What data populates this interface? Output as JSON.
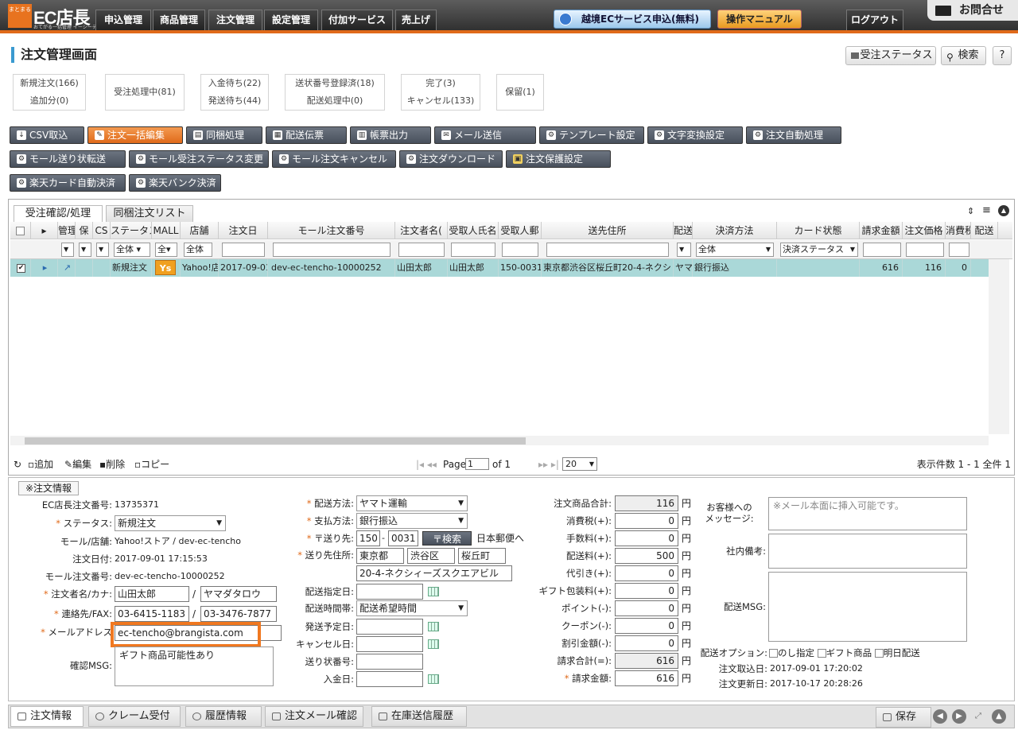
{
  "header": {
    "logo_text": "EC店長",
    "logo_box": "まとまる",
    "logo_sub": "おてがる一括管理 イーシーテンチョウ",
    "nav": [
      "申込管理",
      "商品管理",
      "注文管理",
      "設定管理",
      "付加サービス",
      "売上げ"
    ],
    "cross_border": "越境ECサービス申込(無料)",
    "manual": "操作マニュアル",
    "logout": "ログアウト",
    "contact": "お問合せ"
  },
  "page": {
    "title": "注文管理画面",
    "status_btn": "受注ステータス",
    "search_btn": "検索",
    "help_btn": "?"
  },
  "status_boxes": [
    {
      "l1": "新規注文(166)",
      "l2": "追加分(0)"
    },
    {
      "l1": "受注処理中(81)",
      "l2": ""
    },
    {
      "l1": "入金待ち(22)",
      "l2": "発送待ち(44)"
    },
    {
      "l1": "送状番号登録済(18)",
      "l2": "配送処理中(0)"
    },
    {
      "l1": "完了(3)",
      "l2": "キャンセル(133)"
    },
    {
      "l1": "保留(1)",
      "l2": ""
    }
  ],
  "actions": {
    "row1": [
      "CSV取込",
      "注文一括編集",
      "同梱処理",
      "配送伝票",
      "帳票出力",
      "メール送信",
      "テンプレート設定",
      "文字変換設定",
      "注文自動処理"
    ],
    "row2": [
      "モール送り状転送",
      "モール受注ステータス変更",
      "モール注文キャンセル",
      "注文ダウンロード",
      "注文保護設定"
    ],
    "row3": [
      "楽天カード自動決済",
      "楽天バンク決済"
    ]
  },
  "grid": {
    "tabs": [
      "受注確認/処理",
      "同梱注文リスト"
    ],
    "columns": [
      "管理",
      "保",
      "CS",
      "ステータス",
      "MALL",
      "店舗",
      "注文日",
      "モール注文番号",
      "注文者名(",
      "受取人氏名",
      "受取人郵",
      "送先住所",
      "配送",
      "決済方法",
      "カード状態",
      "請求金額",
      "注文価格",
      "消費税",
      "配送"
    ],
    "filters": {
      "status": "全体",
      "shop": "全体",
      "payment": "全体",
      "card": "決済ステータス"
    },
    "row": {
      "status": "新規注文",
      "mall": "Ys",
      "shop": "Yahoo!店",
      "date": "2017-09-01",
      "order_no": "dev-ec-tencho-10000252",
      "orderer": "山田太郎",
      "receiver": "山田太郎",
      "zip": "150-0031",
      "address": "東京都渋谷区桜丘町20-4-ネクシ",
      "ship": "ヤマ",
      "payment": "銀行振込",
      "amount": "616",
      "price": "116",
      "tax": "0"
    },
    "footer": {
      "add": "追加",
      "edit": "編集",
      "delete": "削除",
      "copy": "コピー",
      "page_label": "Page",
      "page": "1",
      "of": "of 1",
      "per_page": "20",
      "summary": "表示件数 1 - 1 全件 1"
    }
  },
  "order": {
    "section_title": "※注文情報",
    "ec_no_label": "EC店長注文番号:",
    "ec_no": "13735371",
    "status_label": "ステータス:",
    "status": "新規注文",
    "mall_label": "モール/店舗:",
    "mall": "Yahoo!ストア / dev-ec-tencho",
    "date_label": "注文日付:",
    "date": "2017-09-01 17:15:53",
    "mall_no_label": "モール注文番号:",
    "mall_no": "dev-ec-tencho-10000252",
    "name_label": "注文者名/カナ:",
    "name": "山田太郎",
    "kana": "ヤマダタロウ",
    "tel_label": "連絡先/FAX:",
    "tel": "03-6415-1183",
    "fax": "03-3476-7877",
    "mail_label": "メールアドレス",
    "mail": "ec-tencho@brangista.com",
    "confirm_label": "確認MSG:",
    "confirm": "ギフト商品可能性あり",
    "ship_method_label": "配送方法:",
    "ship_method": "ヤマト運輸",
    "pay_label": "支払方法:",
    "pay": "銀行振込",
    "zip_label": "〒送り先:",
    "zip1": "150",
    "zip2": "0031",
    "zip_search": "〒検索",
    "post_link": "日本郵便へ",
    "addr_label": "送り先住所:",
    "pref": "東京都",
    "city": "渋谷区",
    "town": "桜丘町",
    "addr2": "20-4-ネクシィーズスクエアビル",
    "ship_date_label": "配送指定日:",
    "ship_time_label": "配送時間帯:",
    "ship_time": "配送希望時間",
    "send_date_label": "発送予定日:",
    "cancel_date_label": "キャンセル日:",
    "slip_label": "送り状番号:",
    "pay_date_label": "入金日:",
    "totals": [
      {
        "label": "注文商品合計:",
        "value": "116",
        "gray": true
      },
      {
        "label": "消費税(+):",
        "value": "0"
      },
      {
        "label": "手数料(+):",
        "value": "0"
      },
      {
        "label": "配送料(+):",
        "value": "500"
      },
      {
        "label": "代引き(+):",
        "value": "0"
      },
      {
        "label": "ギフト包装料(+):",
        "value": "0"
      },
      {
        "label": "ポイント(-):",
        "value": "0"
      },
      {
        "label": "クーポン(-):",
        "value": "0"
      },
      {
        "label": "割引金額(-):",
        "value": "0"
      },
      {
        "label": "請求合計(=):",
        "value": "616",
        "gray": true
      },
      {
        "label": "請求金額:",
        "value": "616",
        "req": true
      }
    ],
    "yen": "円",
    "msg_label": "お客様への\nメッセージ:",
    "msg_placeholder": "※メール本面に挿入可能です。",
    "memo_label": "社内備考:",
    "ship_msg_label": "配送MSG:",
    "ship_opt_label": "配送オプション:",
    "opt1": "のし指定",
    "opt2": "ギフト商品",
    "opt3": "明日配送",
    "import_label": "注文取込日:",
    "import": "2017-09-01 17:20:02",
    "update_label": "注文更新日:",
    "update": "2017-10-17 20:28:26"
  },
  "bottom_tabs": [
    "注文情報",
    "クレーム受付",
    "履歴情報",
    "注文メール確認",
    "在庫送信履歴"
  ],
  "save": "保存",
  "colors": {
    "accent": "#e06a1a",
    "row_selected": "#aad8d8",
    "highlight_box": "#f07820"
  }
}
